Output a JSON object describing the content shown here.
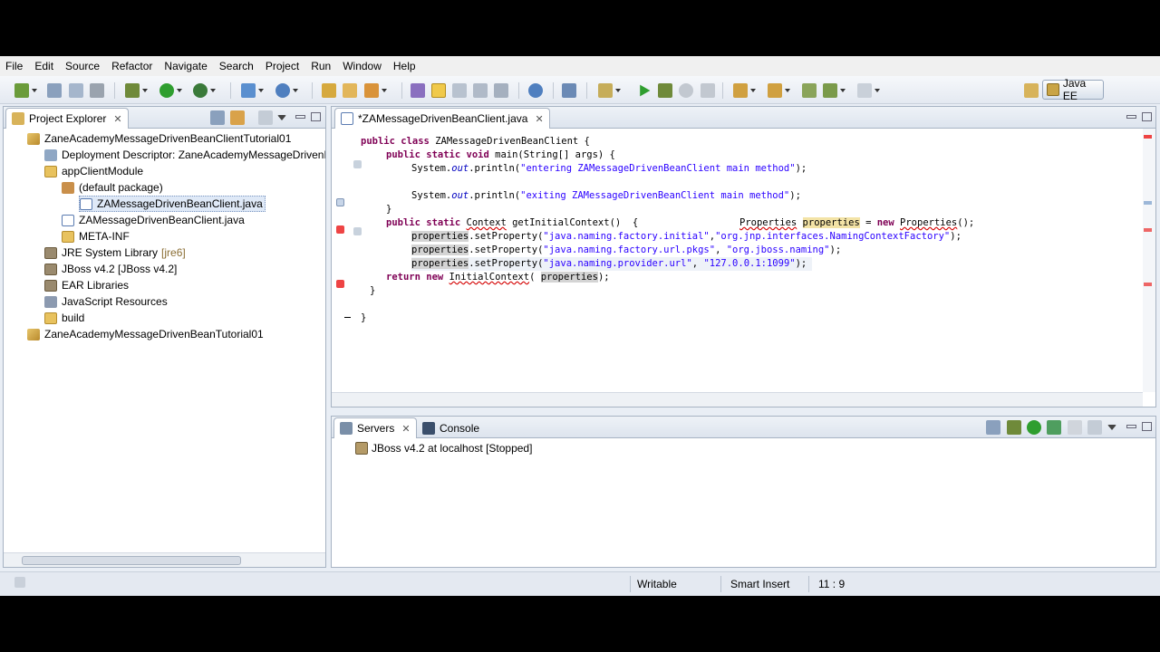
{
  "menubar": [
    "File",
    "Edit",
    "Source",
    "Refactor",
    "Navigate",
    "Search",
    "Project",
    "Run",
    "Window",
    "Help"
  ],
  "perspective": {
    "label": "Java EE"
  },
  "explorer": {
    "title": "Project Explorer",
    "close": "✕",
    "nodes": [
      {
        "label": "ZaneAcademyMessageDrivenBeanClientTutorial01",
        "icon": "project-icon",
        "depth": 0
      },
      {
        "label": "Deployment Descriptor: ZaneAcademyMessageDrivenB",
        "icon": "deployment-descriptor-icon",
        "depth": 1
      },
      {
        "label": "appClientModule",
        "icon": "source-folder-icon",
        "depth": 1
      },
      {
        "label": "(default package)",
        "icon": "package-icon",
        "depth": 2
      },
      {
        "label": "ZAMessageDrivenBeanClient.java",
        "icon": "java-file-icon",
        "depth": 3,
        "selected": true
      },
      {
        "label": "ZAMessageDrivenBeanClient.java",
        "icon": "java-file-icon",
        "depth": 2
      },
      {
        "label": "META-INF",
        "icon": "folder-icon",
        "depth": 2
      },
      {
        "label": "JRE System Library",
        "extra": "[jre6]",
        "icon": "library-icon",
        "depth": 1
      },
      {
        "label": "JBoss v4.2 [JBoss v4.2]",
        "icon": "library-icon",
        "depth": 1
      },
      {
        "label": "EAR Libraries",
        "icon": "library-icon",
        "depth": 1
      },
      {
        "label": "JavaScript Resources",
        "icon": "javascript-icon",
        "depth": 1
      },
      {
        "label": "build",
        "icon": "folder-icon",
        "depth": 1
      },
      {
        "label": "ZaneAcademyMessageDrivenBeanTutorial01",
        "icon": "project-icon",
        "depth": 0
      }
    ]
  },
  "editor": {
    "tab_title": "*ZAMessageDrivenBeanClient.java",
    "close": "✕",
    "code": {
      "l1_kw": "public class",
      "l1_name": "ZAMessageDrivenBeanClient {",
      "l2_kw": "public static void",
      "l2_rest": "main(String[] args) {",
      "l3_a": "System.",
      "l3_out": "out",
      "l3_b": ".println(",
      "l3_str": "\"entering ZAMessageDrivenBeanClient main method\"",
      "l3_c": ");",
      "l4_a": "System.",
      "l4_out": "out",
      "l4_b": ".println(",
      "l4_str": "\"exiting ZAMessageDrivenBeanClient main method\"",
      "l4_c": ");",
      "l5": "}",
      "l6_kw": "public static",
      "l6_ctx": "Context",
      "l6_rest": " getInitialContext()  {",
      "l6_props_type": "Properties",
      "l6_props_var": "properties",
      "l6_eq": " = ",
      "l6_new": "new",
      "l6_ctor": "Properties",
      "l6_end": "();",
      "l7_var": "properties",
      "l7_a": ".setProperty(",
      "l7_s1": "\"java.naming.factory.initial\"",
      "l7_comma": ",",
      "l7_s2": "\"org.jnp.interfaces.NamingContextFactory\"",
      "l7_end": ");",
      "l8_var": "properties",
      "l8_a": ".setProperty(",
      "l8_s1": "\"java.naming.factory.url.pkgs\"",
      "l8_comma": ", ",
      "l8_s2": "\"org.jboss.naming\"",
      "l8_end": ");",
      "l9_var": "properties",
      "l9_a": ".setProperty(",
      "l9_s1": "\"java.naming.provider.url\"",
      "l9_comma": ", ",
      "l9_s2": "\"127.0.0.1:1099\"",
      "l9_end": ");",
      "l10_kw": "return new",
      "l10_ctor": "InitialContext",
      "l10_a": "( ",
      "l10_var": "properties",
      "l10_end": ");",
      "l11": "}",
      "l12": "}"
    }
  },
  "servers": {
    "tab_servers": "Servers",
    "tab_console": "Console",
    "close": "✕",
    "row": "JBoss v4.2 at localhost  [Stopped]"
  },
  "status": {
    "writable": "Writable",
    "insert_mode": "Smart Insert",
    "position": "11 : 9"
  }
}
